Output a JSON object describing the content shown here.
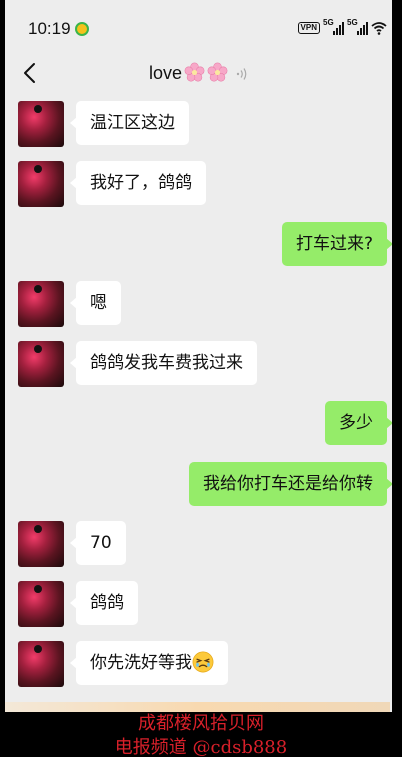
{
  "status": {
    "time": "10:19",
    "vpn": "VPN",
    "network1": "5G",
    "network2": "5G"
  },
  "header": {
    "title": "love"
  },
  "messages": [
    {
      "side": "left",
      "text": "温江区这边"
    },
    {
      "side": "left",
      "text": "我好了，鸽鸽"
    },
    {
      "side": "right",
      "text": "打车过来?"
    },
    {
      "side": "left",
      "text": "嗯"
    },
    {
      "side": "left",
      "text": "鸽鸽发我车费我过来"
    },
    {
      "side": "right",
      "text": "多少"
    },
    {
      "side": "right",
      "text": "我给你打车还是给你转"
    },
    {
      "side": "left",
      "text": "70"
    },
    {
      "side": "left",
      "text": "鸽鸽"
    },
    {
      "side": "left",
      "text": "你先洗好等我"
    }
  ],
  "icons": {
    "back": "chevron-left-icon",
    "title_decoration": "cherry-blossom-icon",
    "voice": "voice-wave-icon",
    "emoji": "tearful-face-emoji"
  },
  "watermark": {
    "line1": "成都楼风拾贝网",
    "line2": "电报频道 @cdsb888"
  },
  "colors": {
    "chat_bg": "#ededed",
    "bubble_left": "#ffffff",
    "bubble_right": "#95ec69",
    "watermark": "#d8202a"
  }
}
